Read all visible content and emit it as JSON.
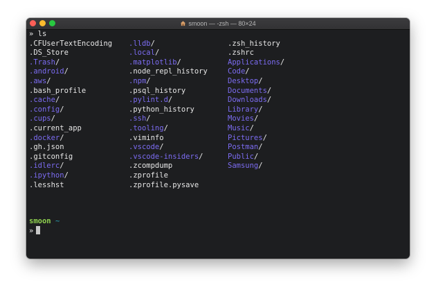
{
  "window": {
    "title": "smoon — -zsh — 80×24"
  },
  "terminal": {
    "command_prompt": "»",
    "command": "ls",
    "columns": [
      [
        {
          "name": ".CFUserTextEncoding",
          "type": "file"
        },
        {
          "name": ".DS_Store",
          "type": "file"
        },
        {
          "name": ".Trash",
          "type": "dir"
        },
        {
          "name": ".android",
          "type": "dir"
        },
        {
          "name": ".aws",
          "type": "dir"
        },
        {
          "name": ".bash_profile",
          "type": "file"
        },
        {
          "name": ".cache",
          "type": "dir"
        },
        {
          "name": ".config",
          "type": "dir"
        },
        {
          "name": ".cups",
          "type": "dir"
        },
        {
          "name": ".current_app",
          "type": "file"
        },
        {
          "name": ".docker",
          "type": "dir"
        },
        {
          "name": ".gh.json",
          "type": "file"
        },
        {
          "name": ".gitconfig",
          "type": "file"
        },
        {
          "name": ".idlerc",
          "type": "dir"
        },
        {
          "name": ".ipython",
          "type": "dir"
        },
        {
          "name": ".lesshst",
          "type": "file"
        }
      ],
      [
        {
          "name": ".lldb",
          "type": "dir"
        },
        {
          "name": ".local",
          "type": "dir"
        },
        {
          "name": ".matplotlib",
          "type": "dir"
        },
        {
          "name": ".node_repl_history",
          "type": "file"
        },
        {
          "name": ".npm",
          "type": "dir"
        },
        {
          "name": ".psql_history",
          "type": "file"
        },
        {
          "name": ".pylint.d",
          "type": "dir"
        },
        {
          "name": ".python_history",
          "type": "file"
        },
        {
          "name": ".ssh",
          "type": "dir"
        },
        {
          "name": ".tooling",
          "type": "dir"
        },
        {
          "name": ".viminfo",
          "type": "file"
        },
        {
          "name": ".vscode",
          "type": "dir"
        },
        {
          "name": ".vscode-insiders",
          "type": "dir"
        },
        {
          "name": ".zcompdump",
          "type": "file"
        },
        {
          "name": ".zprofile",
          "type": "file"
        },
        {
          "name": ".zprofile.pysave",
          "type": "file"
        }
      ],
      [
        {
          "name": ".zsh_history",
          "type": "file"
        },
        {
          "name": ".zshrc",
          "type": "file"
        },
        {
          "name": "Applications",
          "type": "dir"
        },
        {
          "name": "Code",
          "type": "dir"
        },
        {
          "name": "Desktop",
          "type": "dir"
        },
        {
          "name": "Documents",
          "type": "dir"
        },
        {
          "name": "Downloads",
          "type": "dir"
        },
        {
          "name": "Library",
          "type": "dir"
        },
        {
          "name": "Movies",
          "type": "dir"
        },
        {
          "name": "Music",
          "type": "dir"
        },
        {
          "name": "Pictures",
          "type": "dir"
        },
        {
          "name": "Postman",
          "type": "dir"
        },
        {
          "name": "Public",
          "type": "dir"
        },
        {
          "name": "Samsung",
          "type": "dir"
        }
      ]
    ],
    "prompt_user": "smoon",
    "prompt_dir": "~",
    "input_prompt": "»",
    "input_value": ""
  },
  "colors": {
    "background": "#1d1e20",
    "directory": "#7c6cf2",
    "user": "#8fd14f",
    "path": "#2aa1b3",
    "text": "#e6e6e6"
  },
  "icons": {
    "title_icon": "home-icon"
  }
}
